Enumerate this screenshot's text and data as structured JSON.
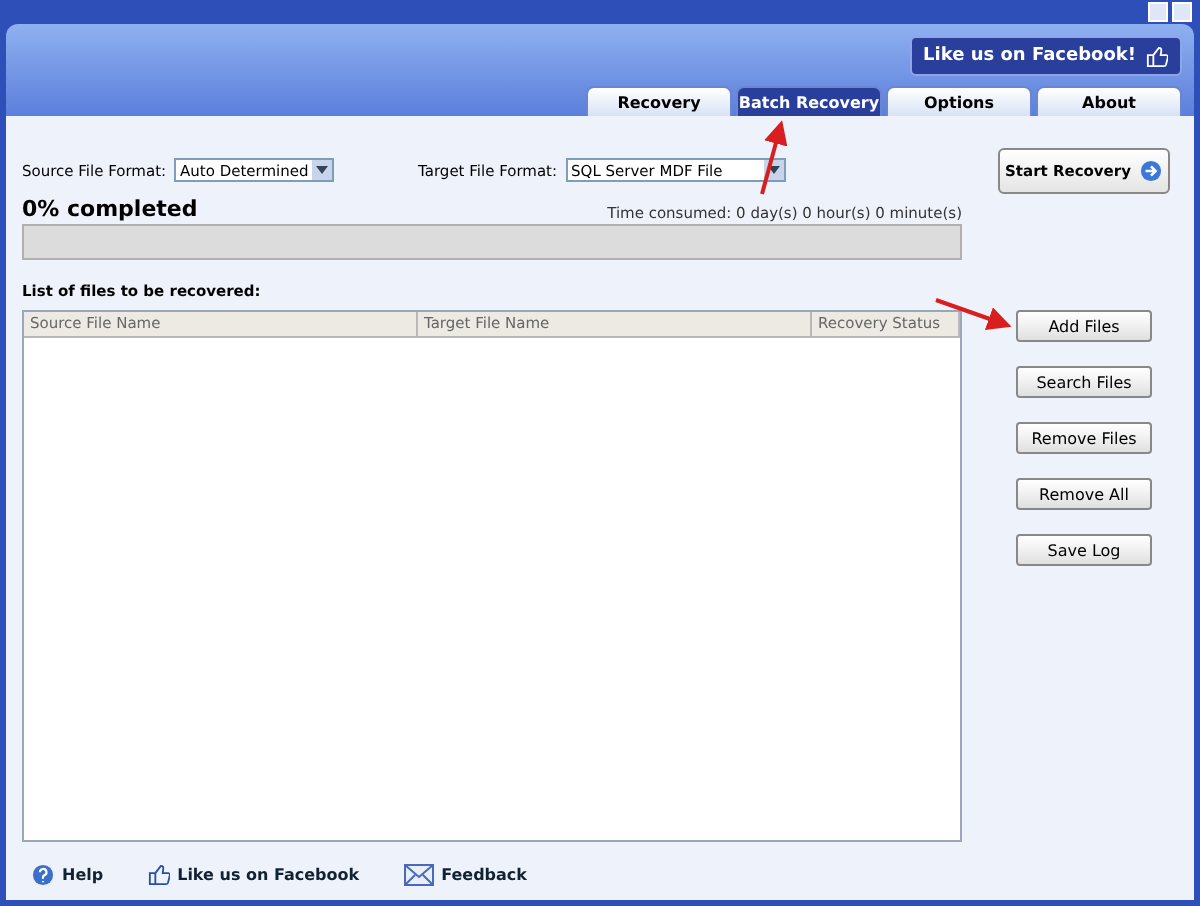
{
  "facebook_button": {
    "label": "Like us on Facebook!"
  },
  "tabs": [
    {
      "label": "Recovery",
      "selected": false
    },
    {
      "label": "Batch Recovery",
      "selected": true
    },
    {
      "label": "Options",
      "selected": false
    },
    {
      "label": "About",
      "selected": false
    }
  ],
  "source_format": {
    "label": "Source File Format:",
    "value": "Auto Determined"
  },
  "target_format": {
    "label": "Target File Format:",
    "value": "SQL Server MDF File"
  },
  "start_button": {
    "label": "Start Recovery"
  },
  "progress": {
    "label": "0% completed",
    "level": 0,
    "time": "Time consumed:  0 day(s) 0 hour(s) 0 minute(s)"
  },
  "list_title": "List of files to be recovered:",
  "table": {
    "columns": [
      "Source File Name",
      "Target File Name",
      "Recovery Status"
    ]
  },
  "side_buttons": [
    "Add Files",
    "Search Files",
    "Remove Files",
    "Remove All",
    "Save Log"
  ],
  "footer": [
    {
      "kind": "help",
      "label": "Help"
    },
    {
      "kind": "facebook",
      "label": "Like us on Facebook"
    },
    {
      "kind": "feedback",
      "label": "Feedback"
    }
  ]
}
